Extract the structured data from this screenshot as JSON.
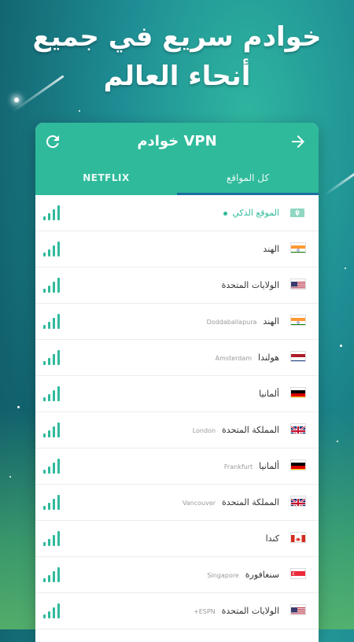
{
  "headline": {
    "line1": "خوادم سريع في جميع",
    "line2": "أنحاء العالم"
  },
  "appbar": {
    "title": "خوادم VPN",
    "refresh_icon": "refresh-icon",
    "arrow_icon": "arrow-right-icon",
    "color": "#2fba9b"
  },
  "tabs": {
    "netflix": "NETFLIX",
    "all_locations": "كل المواقع",
    "active": "all_locations"
  },
  "servers": [
    {
      "country": "الموقع الذكي",
      "city": "",
      "flag": "smart-location-icon",
      "smart": true,
      "signal": 4
    },
    {
      "country": "الهند",
      "city": "",
      "flag": "india-flag-icon",
      "signal": 4
    },
    {
      "country": "الولايات المتحدة",
      "city": "",
      "flag": "usa-flag-icon",
      "signal": 4
    },
    {
      "country": "الهند",
      "city": "Doddaballapura",
      "flag": "india-flag-icon",
      "signal": 4
    },
    {
      "country": "هولندا",
      "city": "Amsterdam",
      "flag": "netherlands-flag-icon",
      "signal": 4
    },
    {
      "country": "ألمانيا",
      "city": "",
      "flag": "germany-flag-icon",
      "signal": 4
    },
    {
      "country": "المملكة المتحدة",
      "city": "London",
      "flag": "uk-flag-icon",
      "signal": 4
    },
    {
      "country": "ألمانيا",
      "city": "Frankfurt",
      "flag": "germany-flag-icon",
      "signal": 4
    },
    {
      "country": "المملكة المتحدة",
      "city": "Vancouver",
      "flag": "uk-flag-icon",
      "signal": 4
    },
    {
      "country": "كندا",
      "city": "",
      "flag": "canada-flag-icon",
      "signal": 4
    },
    {
      "country": "سنغافورة",
      "city": "Singapore",
      "flag": "singapore-flag-icon",
      "signal": 4
    },
    {
      "country": "الولايات المتحدة",
      "city": "ESPN+",
      "flag": "usa-flag-icon",
      "signal": 4
    }
  ]
}
